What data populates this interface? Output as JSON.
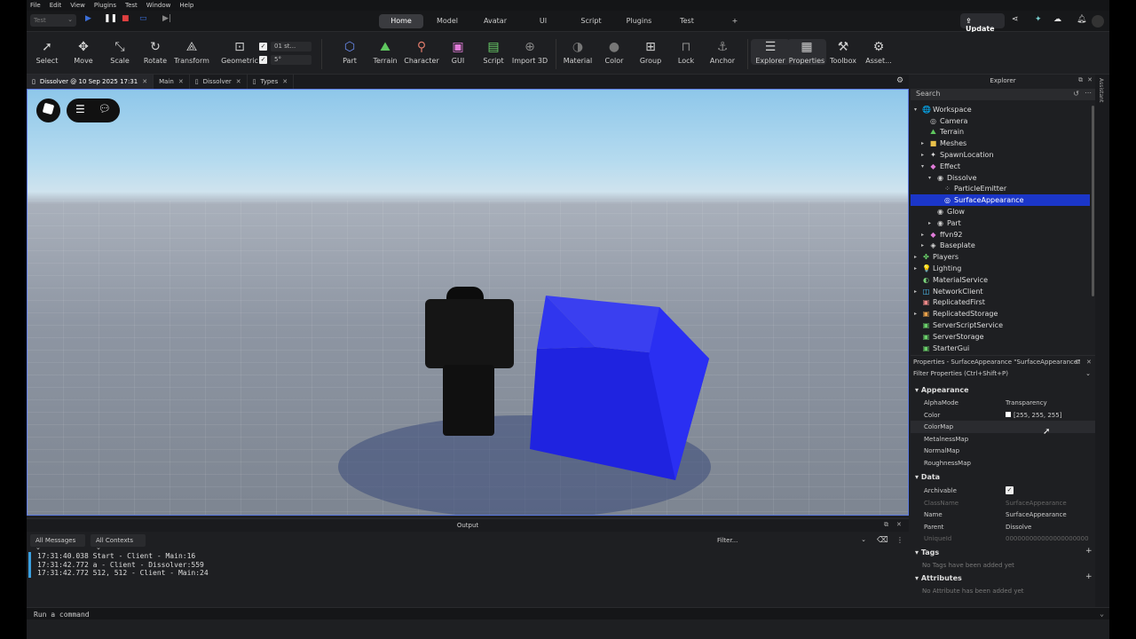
{
  "menubar": [
    "File",
    "Edit",
    "View",
    "Plugins",
    "Test",
    "Window",
    "Help"
  ],
  "mode": "Test",
  "nav_tabs": [
    "Home",
    "Model",
    "Avatar",
    "UI",
    "Script",
    "Plugins",
    "Test",
    "+"
  ],
  "update_label": "Update",
  "toolbar": {
    "tools_left": [
      "Select",
      "Move",
      "Scale",
      "Rotate",
      "Transform"
    ],
    "geometric": "Geometric",
    "snap_move": "01 st...",
    "snap_rotate": "5°",
    "tools_mid": [
      "Part",
      "Terrain",
      "Character",
      "GUI",
      "Script",
      "Import 3D"
    ],
    "tools_right": [
      "Material",
      "Color",
      "Group",
      "Lock",
      "Anchor"
    ],
    "tools_far": [
      "Explorer",
      "Properties",
      "Toolbox",
      "Asset..."
    ]
  },
  "doc_tabs": [
    "Dissolver @ 10 Sep 2025 17:31",
    "Main",
    "Dissolver",
    "Types"
  ],
  "output": {
    "title": "Output",
    "filter_messages": "All Messages",
    "filter_contexts": "All Contexts",
    "filter_placeholder": "Filter...",
    "lines": [
      "17:31:40.038  Start  -  Client - Main:16",
      "17:31:42.772  a  -  Client - Dissolver:559",
      "17:31:42.772  512, 512  -  Client - Main:24"
    ]
  },
  "command_placeholder": "Run a command",
  "explorer": {
    "title": "Explorer",
    "search_placeholder": "Search",
    "items": [
      {
        "label": "Workspace",
        "indent": 0,
        "arrow": "▾",
        "icon": "🌐",
        "color": "#4fc3f7"
      },
      {
        "label": "Camera",
        "indent": 1,
        "arrow": "",
        "icon": "◎",
        "color": "#ccc"
      },
      {
        "label": "Terrain",
        "indent": 1,
        "arrow": "",
        "icon": "⛰",
        "color": "#5fc75f"
      },
      {
        "label": "Meshes",
        "indent": 1,
        "arrow": "▸",
        "icon": "■",
        "color": "#e8c04a"
      },
      {
        "label": "SpawnLocation",
        "indent": 1,
        "arrow": "▸",
        "icon": "✦",
        "color": "#ddd"
      },
      {
        "label": "Effect",
        "indent": 1,
        "arrow": "▾",
        "icon": "◆",
        "color": "#e07bd8"
      },
      {
        "label": "Dissolve",
        "indent": 2,
        "arrow": "▾",
        "icon": "◉",
        "color": "#ccc"
      },
      {
        "label": "ParticleEmitter",
        "indent": 3,
        "arrow": "",
        "icon": "⁘",
        "color": "#bbb"
      },
      {
        "label": "SurfaceAppearance",
        "indent": 3,
        "arrow": "",
        "icon": "◎",
        "color": "#fff",
        "selected": true
      },
      {
        "label": "Glow",
        "indent": 2,
        "arrow": "",
        "icon": "◉",
        "color": "#ccc"
      },
      {
        "label": "Part",
        "indent": 2,
        "arrow": "▸",
        "icon": "◉",
        "color": "#ccc"
      },
      {
        "label": "ffvn92",
        "indent": 1,
        "arrow": "▸",
        "icon": "◆",
        "color": "#e07bd8"
      },
      {
        "label": "Baseplate",
        "indent": 1,
        "arrow": "▸",
        "icon": "◈",
        "color": "#ddd"
      },
      {
        "label": "Players",
        "indent": 0,
        "arrow": "▸",
        "icon": "✤",
        "color": "#6ad16a"
      },
      {
        "label": "Lighting",
        "indent": 0,
        "arrow": "▸",
        "icon": "💡",
        "color": "#f2d34a"
      },
      {
        "label": "MaterialService",
        "indent": 0,
        "arrow": "",
        "icon": "◐",
        "color": "#7bd47b"
      },
      {
        "label": "NetworkClient",
        "indent": 0,
        "arrow": "▸",
        "icon": "◫",
        "color": "#4fc3f7"
      },
      {
        "label": "ReplicatedFirst",
        "indent": 0,
        "arrow": "",
        "icon": "▣",
        "color": "#e88"
      },
      {
        "label": "ReplicatedStorage",
        "indent": 0,
        "arrow": "▸",
        "icon": "▣",
        "color": "#e8a04a"
      },
      {
        "label": "ServerScriptService",
        "indent": 0,
        "arrow": "",
        "icon": "▣",
        "color": "#6ad16a"
      },
      {
        "label": "ServerStorage",
        "indent": 0,
        "arrow": "",
        "icon": "▣",
        "color": "#6ad16a"
      },
      {
        "label": "StarterGui",
        "indent": 0,
        "arrow": "",
        "icon": "▣",
        "color": "#6ad16a"
      }
    ]
  },
  "properties": {
    "title": "Properties - SurfaceAppearance \"SurfaceAppearance\"",
    "filter_placeholder": "Filter Properties (Ctrl+Shift+P)",
    "appearance_title": "Appearance",
    "appearance": [
      {
        "key": "AlphaMode",
        "value": "Transparency"
      },
      {
        "key": "Color",
        "value": "[255, 255, 255]",
        "swatch": "#ffffff"
      },
      {
        "key": "ColorMap",
        "value": ""
      },
      {
        "key": "MetalnessMap",
        "value": ""
      },
      {
        "key": "NormalMap",
        "value": ""
      },
      {
        "key": "RoughnessMap",
        "value": ""
      }
    ],
    "data_title": "Data",
    "data": [
      {
        "key": "Archivable",
        "value": "✓",
        "check": true
      },
      {
        "key": "ClassName",
        "value": "SurfaceAppearance",
        "dim": true
      },
      {
        "key": "Name",
        "value": "SurfaceAppearance"
      },
      {
        "key": "Parent",
        "value": "Dissolve"
      },
      {
        "key": "UniqueId",
        "value": "000000000000000000000",
        "dim": true
      }
    ],
    "tags_title": "Tags",
    "tags_empty": "No Tags have been added yet",
    "attributes_title": "Attributes",
    "attributes_empty": "No Attribute has been added yet"
  },
  "rail_label": "Assistant"
}
